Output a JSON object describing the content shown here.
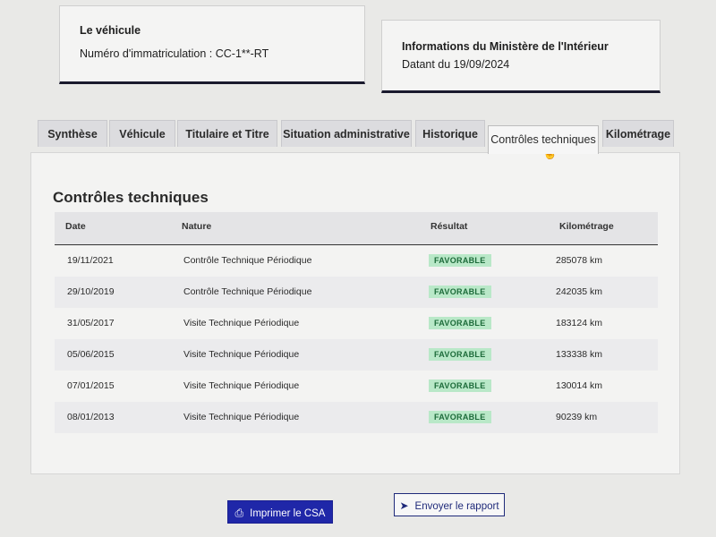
{
  "vehicle": {
    "title": "Le véhicule",
    "registration": "Numéro d'immatriculation : CC-1**-RT"
  },
  "ministry": {
    "title": "Informations du Ministère de l'Intérieur",
    "date": "Datant du 19/09/2024"
  },
  "tabs": [
    {
      "label": "Synthèse"
    },
    {
      "label": "Véhicule"
    },
    {
      "label": "Titulaire et Titre"
    },
    {
      "label": "Situation administrative"
    },
    {
      "label": "Historique"
    },
    {
      "label": "Contrôles techniques"
    },
    {
      "label": "Kilométrage"
    }
  ],
  "active_tab": "Contrôles techniques",
  "section": {
    "title": "Contrôles techniques"
  },
  "table": {
    "headers": [
      "Date",
      "Nature",
      "Résultat",
      "Kilométrage"
    ],
    "rows": [
      {
        "date": "19/11/2021",
        "nature": "Contrôle Technique Périodique",
        "result": "FAVORABLE",
        "km": "285078 km"
      },
      {
        "date": "29/10/2019",
        "nature": "Contrôle Technique Périodique",
        "result": "FAVORABLE",
        "km": "242035 km"
      },
      {
        "date": "31/05/2017",
        "nature": "Visite Technique Périodique",
        "result": "FAVORABLE",
        "km": "183124 km"
      },
      {
        "date": "05/06/2015",
        "nature": "Visite Technique Périodique",
        "result": "FAVORABLE",
        "km": "133338 km"
      },
      {
        "date": "07/01/2015",
        "nature": "Visite Technique Périodique",
        "result": "FAVORABLE",
        "km": "130014 km"
      },
      {
        "date": "08/01/2013",
        "nature": "Visite Technique Périodique",
        "result": "FAVORABLE",
        "km": "90239 km"
      }
    ]
  },
  "buttons": {
    "print_label": "Imprimer le CSA",
    "send_label": "Envoyer le rapport"
  },
  "icons": {
    "print": "printer-icon",
    "send": "send-arrow-icon",
    "cursor": "hand-pointer-icon"
  },
  "colors": {
    "primary": "#1f27a8",
    "badge_bg": "#b9e8c8",
    "badge_text": "#1d6b3a"
  }
}
